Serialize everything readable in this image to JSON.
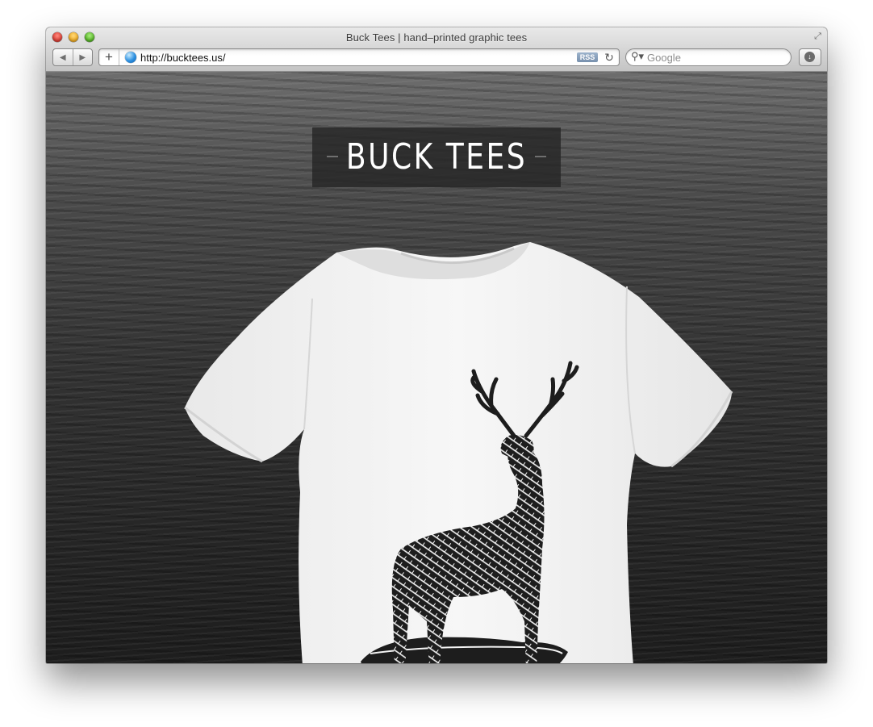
{
  "window": {
    "title": "Buck Tees | hand–printed graphic tees"
  },
  "toolbar": {
    "back_icon": "back-arrow-icon",
    "forward_icon": "forward-arrow-icon",
    "add_tab_label": "+",
    "url": "http://bucktees.us/",
    "rss_label": "RSS",
    "reload_label": "↻",
    "search_placeholder": "Google"
  },
  "page": {
    "logo_text": "BUCK TEES",
    "hero_image": "white t-shirt with deer illustration",
    "colors": {
      "background": "#2a2a2a",
      "logo_box": "#262626",
      "logo_text": "#ffffff",
      "shirt": "#f4f4f4"
    }
  }
}
